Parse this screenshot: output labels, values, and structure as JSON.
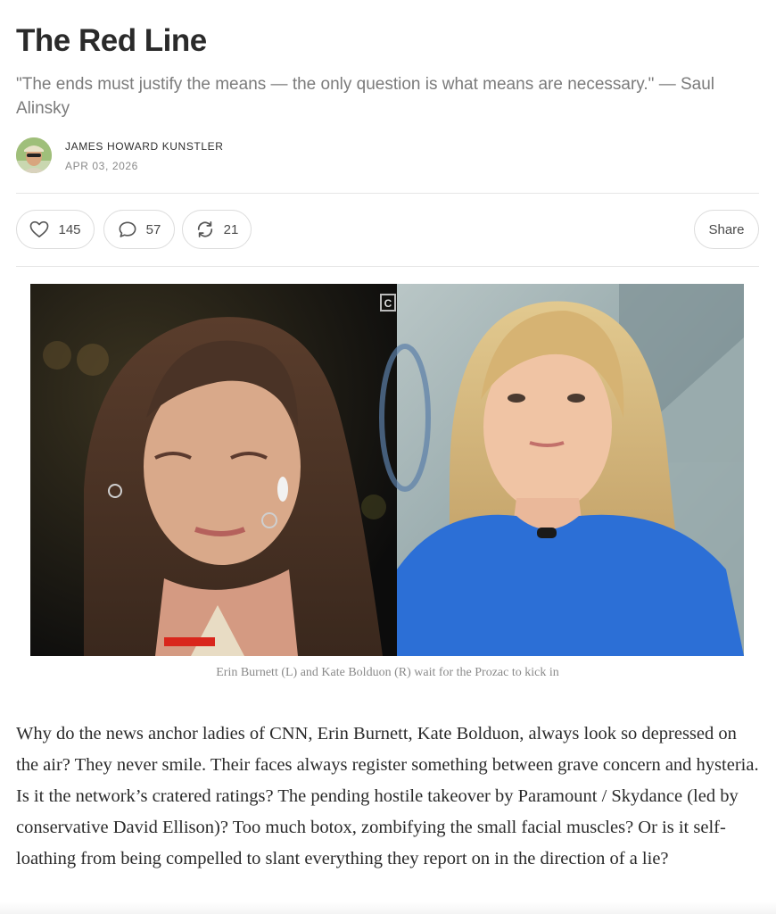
{
  "post": {
    "title": "The Red Line",
    "subtitle": "\"The ends must justify the means — the only question is what means are necessary.\" — Saul Alinsky",
    "author": "JAMES HOWARD KUNSTLER",
    "date": "APR 03, 2026"
  },
  "actions": {
    "likes": "145",
    "comments": "57",
    "restacks": "21",
    "share_label": "Share"
  },
  "figure": {
    "caption": "Erin Burnett (L) and Kate Bolduon (R) wait for the Prozac to kick in",
    "badge": "C"
  },
  "body": {
    "paragraph_1": "Why do the news anchor ladies of CNN, Erin Burnett, Kate Bolduon, always look so depressed on the air? They never smile. Their faces always register something between grave concern and hysteria. Is it the network’s cratered ratings? The pending hostile takeover by Paramount / Skydance (led by conservative David Ellison)? Too much botox, zombifying the small facial muscles? Or is it self-loathing from being compelled to slant everything they report on in the direction of a lie?"
  },
  "icons": {
    "like": "heart-icon",
    "comment": "comment-bubble-icon",
    "restack": "restack-arrows-icon"
  },
  "colors": {
    "red_bar": "#d9261c",
    "blue_sweater": "#2c6fd6"
  }
}
